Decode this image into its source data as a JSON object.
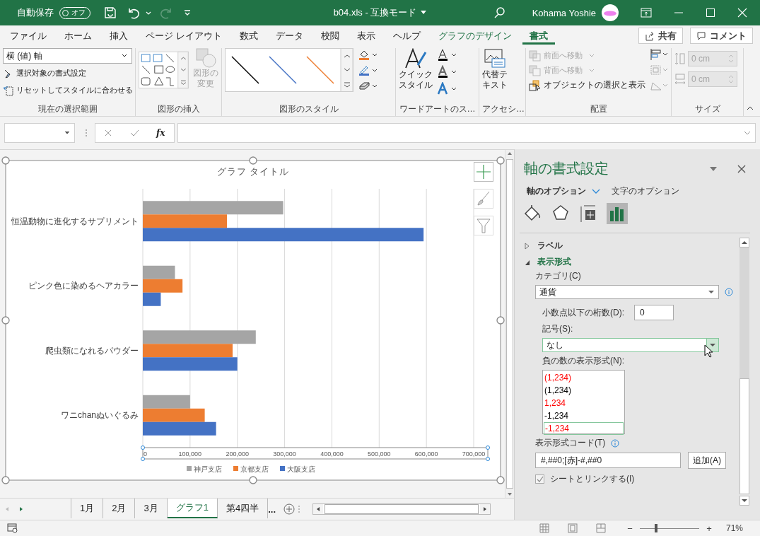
{
  "title_bar": {
    "autosave_label": "自動保存",
    "autosave_toggle": {
      "label": "オフ",
      "on": false
    },
    "document_title": "b04.xls  -  互換モード",
    "user_name": "Kohama Yoshie"
  },
  "ribbon_tabs": [
    {
      "label": "ファイル",
      "selected": false,
      "kind": "normal"
    },
    {
      "label": "ホーム",
      "selected": false,
      "kind": "normal"
    },
    {
      "label": "挿入",
      "selected": false,
      "kind": "normal"
    },
    {
      "label": "ページ レイアウト",
      "selected": false,
      "kind": "normal"
    },
    {
      "label": "数式",
      "selected": false,
      "kind": "normal"
    },
    {
      "label": "データ",
      "selected": false,
      "kind": "normal"
    },
    {
      "label": "校閲",
      "selected": false,
      "kind": "normal"
    },
    {
      "label": "表示",
      "selected": false,
      "kind": "normal"
    },
    {
      "label": "ヘルプ",
      "selected": false,
      "kind": "normal"
    },
    {
      "label": "グラフのデザイン",
      "selected": false,
      "kind": "contextual"
    },
    {
      "label": "書式",
      "selected": true,
      "kind": "contextual"
    }
  ],
  "share_button": "共有",
  "comment_button": "コメント",
  "ribbon": {
    "selection": {
      "dropdown": "横 (値) 軸",
      "format_selection": "選択対象の書式設定",
      "reset_style": "リセットしてスタイルに合わせる",
      "group_label": "現在の選択範囲"
    },
    "insert_shapes": {
      "change_shape": {
        "lines": [
          "図形の",
          "変更"
        ],
        "disabled": true
      },
      "group_label": "図形の挿入"
    },
    "shape_styles": {
      "group_label": "図形のスタイル"
    },
    "wordart": {
      "quick_styles": [
        "クイック",
        "スタイル"
      ],
      "group_label": "ワードアートのス…"
    },
    "accessibility": {
      "alt_text": [
        "代替テ",
        "キスト"
      ],
      "group_label": "アクセシ…"
    },
    "arrange": {
      "bring_forward": {
        "label": "前面へ移動",
        "disabled": true
      },
      "send_backward": {
        "label": "背面へ移動",
        "disabled": true
      },
      "selection_pane": "オブジェクトの選択と表示",
      "group_label": "配置"
    },
    "size": {
      "height": {
        "value": "0 cm",
        "disabled": true
      },
      "width": {
        "value": "0 cm",
        "disabled": true
      },
      "group_label": "サイズ"
    }
  },
  "formula_bar": {
    "function_label": "fx"
  },
  "chart": {
    "chart_data": {
      "type": "bar",
      "orientation": "horizontal",
      "title": "グラフ タイトル",
      "categories": [
        "恒温動物に進化するサプリメント",
        "ピンク色に染めるヘアカラー",
        "爬虫類になれるパウダー",
        "ワニchanぬいぐるみ"
      ],
      "series": [
        {
          "name": "神戸支店",
          "color": "#a5a5a5",
          "values": [
            297000,
            68000,
            239000,
            100000
          ]
        },
        {
          "name": "京都支店",
          "color": "#ed7d31",
          "values": [
            178000,
            84000,
            190000,
            131000
          ]
        },
        {
          "name": "大阪支店",
          "color": "#4472c4",
          "values": [
            594000,
            38000,
            200000,
            155000
          ]
        }
      ],
      "xlim": [
        0,
        700000
      ],
      "grid": true,
      "legend": true,
      "xticks": [
        {
          "value": 0,
          "label": "0"
        },
        {
          "value": 100000,
          "label": "100,000"
        },
        {
          "value": 200000,
          "label": "200,000"
        },
        {
          "value": 300000,
          "label": "300,000"
        },
        {
          "value": 400000,
          "label": "400,000"
        },
        {
          "value": 500000,
          "label": "500,000"
        },
        {
          "value": 600000,
          "label": "600,000"
        },
        {
          "value": 700000,
          "label": "700,000"
        }
      ]
    }
  },
  "format_pane": {
    "title": "軸の書式設定",
    "tabs": [
      {
        "label": "軸のオプション",
        "selected": true
      },
      {
        "label": "文字のオプション",
        "selected": false
      }
    ],
    "icon_tabs": [
      {
        "kind": "fill",
        "selected": false
      },
      {
        "kind": "effects",
        "selected": false
      },
      {
        "kind": "size",
        "selected": false
      },
      {
        "kind": "axis",
        "selected": true
      }
    ],
    "sections": [
      {
        "label": "ラベル",
        "expanded": false
      },
      {
        "label": "表示形式",
        "expanded": true
      }
    ],
    "category_label": "カテゴリ(C)",
    "category_value": "通貨",
    "decimals_label": "小数点以下の桁数(D):",
    "decimals_value": "0",
    "symbol_label": "記号(S):",
    "symbol_value": "なし",
    "negative_label": "負の数の表示形式(N):",
    "negative_formats": [
      {
        "text": "(1,234)",
        "color": "#ff0000",
        "selected": false
      },
      {
        "text": "(1,234)",
        "color": "#000000",
        "selected": false
      },
      {
        "text": "1,234",
        "color": "#ff0000",
        "selected": false
      },
      {
        "text": "-1,234",
        "color": "#000000",
        "selected": false
      },
      {
        "text": "-1,234",
        "color": "#ff0000",
        "selected": true
      }
    ],
    "format_code_label": "表示形式コード(T)",
    "format_code_value": "#,##0;[赤]-#,##0",
    "add_button": "追加(A)",
    "link_checkbox": {
      "label": "シートとリンクする(I)",
      "checked": true
    }
  },
  "sheet_tabs": [
    {
      "label": "1月",
      "selected": false
    },
    {
      "label": "2月",
      "selected": false
    },
    {
      "label": "3月",
      "selected": false
    },
    {
      "label": "グラフ1",
      "selected": true
    },
    {
      "label": "第4四半",
      "selected": false
    }
  ],
  "more_tabs": "...",
  "status_bar": {
    "zoom_minus": "−",
    "zoom_plus": "+",
    "level": 0.27,
    "zoom_percent": "71%"
  }
}
